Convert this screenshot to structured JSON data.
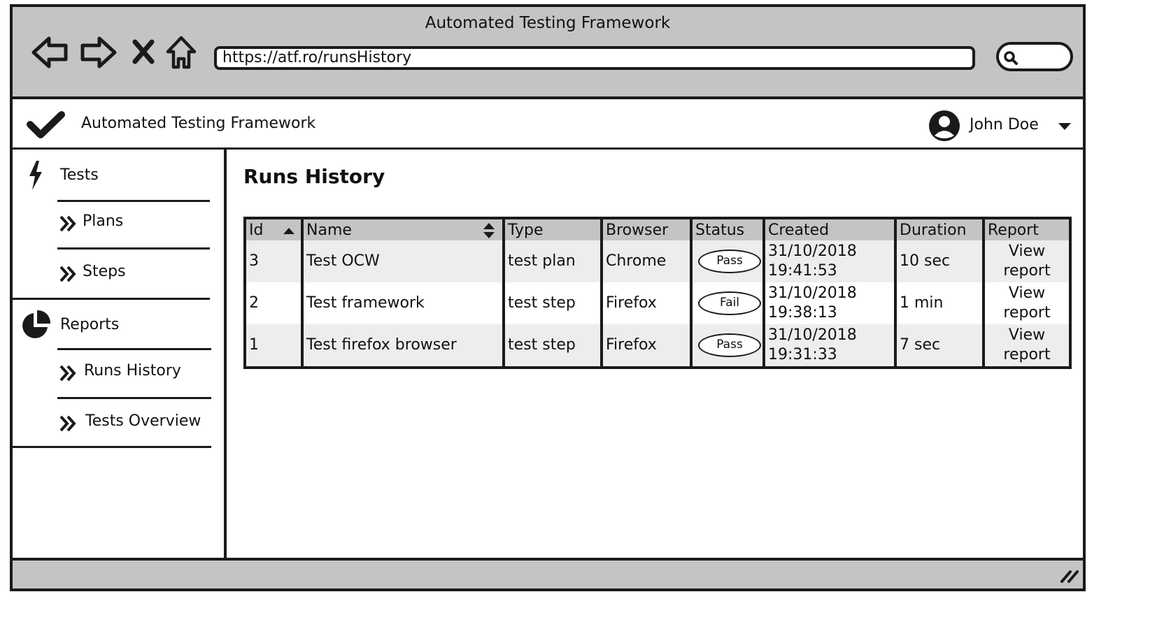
{
  "window": {
    "title": "Automated Testing Framework"
  },
  "browser": {
    "url": "https://atf.ro/runsHistory"
  },
  "header": {
    "app_title": "Automated Testing Framework",
    "user_name": "John Doe"
  },
  "sidebar": {
    "sections": [
      {
        "label": "Tests",
        "icon": "lightning-icon",
        "items": [
          "Plans",
          "Steps"
        ]
      },
      {
        "label": "Reports",
        "icon": "pie-chart-icon",
        "items": [
          "Runs History",
          "Tests Overview"
        ]
      }
    ]
  },
  "main": {
    "title": "Runs History",
    "table": {
      "columns": [
        "Id",
        "Name",
        "Type",
        "Browser",
        "Status",
        "Created",
        "Duration",
        "Report"
      ],
      "rows": [
        {
          "id": "3",
          "name": "Test OCW",
          "type": "test plan",
          "browser": "Chrome",
          "status": "Pass",
          "created_date": "31/10/2018",
          "created_time": "19:41:53",
          "duration": "10 sec",
          "report_line1": "View",
          "report_line2": "report"
        },
        {
          "id": "2",
          "name": "Test framework",
          "type": "test step",
          "browser": "Firefox",
          "status": "Fail",
          "created_date": "31/10/2018",
          "created_time": "19:38:13",
          "duration": "1 min",
          "report_line1": "View",
          "report_line2": "report"
        },
        {
          "id": "1",
          "name": "Test firefox browser",
          "type": "test step",
          "browser": "Firefox",
          "status": "Pass",
          "created_date": "31/10/2018",
          "created_time": "19:31:33",
          "duration": "7 sec",
          "report_line1": "View",
          "report_line2": "report"
        }
      ]
    }
  }
}
